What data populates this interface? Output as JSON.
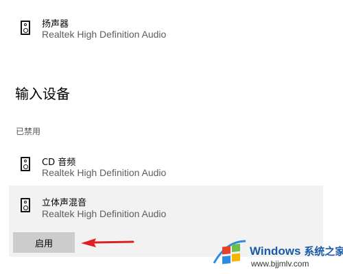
{
  "output_device": {
    "name": "扬声器",
    "driver": "Realtek High Definition Audio"
  },
  "input_section": {
    "title": "输入设备",
    "disabled_label": "已禁用"
  },
  "input_devices": [
    {
      "name": "CD 音频",
      "driver": "Realtek High Definition Audio"
    },
    {
      "name": "立体声混音",
      "driver": "Realtek High Definition Audio"
    }
  ],
  "enable_button_label": "启用",
  "annotation": {
    "arrow_color": "#e02020"
  },
  "watermark": {
    "brand": "Windows",
    "brand_suffix": "系统之家",
    "url": "www.bjjmlv.com"
  },
  "icons": {
    "device": "speaker-icon",
    "logo": "windows-logo-icon"
  }
}
